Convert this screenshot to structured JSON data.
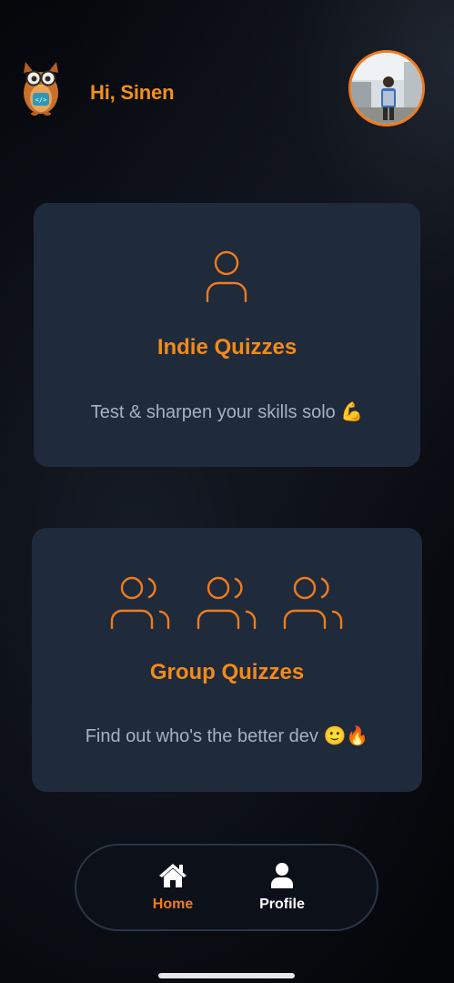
{
  "header": {
    "greeting": "Hi, Sinen",
    "logo_icon": "owl-logo-icon",
    "avatar_icon": "user-avatar"
  },
  "cards": [
    {
      "id": "indie",
      "title": "Indie Quizzes",
      "description": "Test & sharpen your skills solo 💪",
      "icon": "person-icon"
    },
    {
      "id": "group",
      "title": "Group Quizzes",
      "description": "Find out who's the better dev 🙂🔥",
      "icon": "users-icon"
    }
  ],
  "bottom_nav": {
    "items": [
      {
        "label": "Home",
        "icon": "home-icon",
        "active": true
      },
      {
        "label": "Profile",
        "icon": "user-icon",
        "active": false
      }
    ]
  },
  "colors": {
    "accent": "#f39019",
    "card_bg": "#1f2a3b",
    "muted_text": "#a7b1c0",
    "background": "#000000"
  }
}
